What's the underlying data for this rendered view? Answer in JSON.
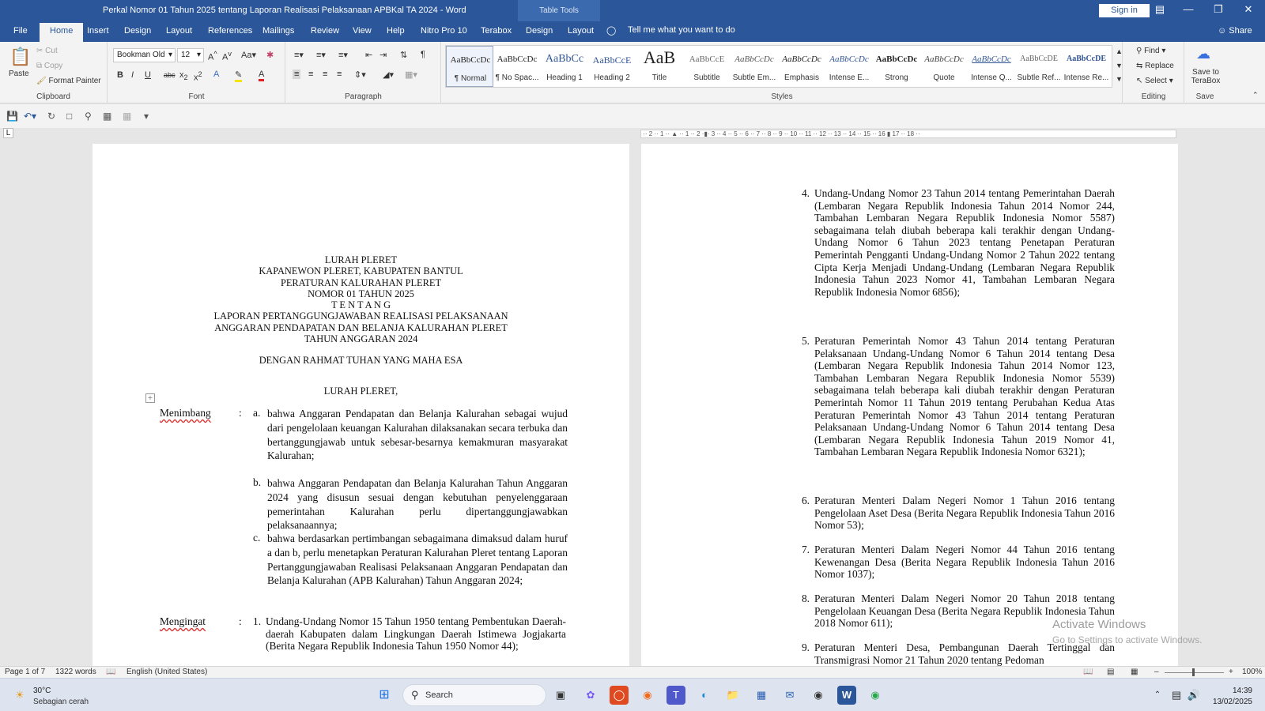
{
  "window": {
    "title": "Perkal Nomor 01 Tahun 2025 tentang Laporan Realisasi Pelaksanaan APBKal TA 2024  -  Word",
    "context_tab": "Table Tools",
    "sign_in": "Sign in"
  },
  "tabs": [
    "File",
    "Home",
    "Insert",
    "Design",
    "Layout",
    "References",
    "Mailings",
    "Review",
    "View",
    "Help",
    "Nitro Pro 10",
    "Terabox",
    "Design",
    "Layout"
  ],
  "active_tab": "Home",
  "tell_me": "Tell me what you want to do",
  "share": "Share",
  "ribbon": {
    "clipboard": {
      "label": "Clipboard",
      "paste": "Paste",
      "cut": "Cut",
      "copy": "Copy",
      "format_painter": "Format Painter"
    },
    "font": {
      "label": "Font",
      "name": "Bookman Old",
      "size": "12"
    },
    "paragraph": {
      "label": "Paragraph"
    },
    "styles": {
      "label": "Styles",
      "items": [
        {
          "preview": "AaBbCcDc",
          "name": "¶ Normal"
        },
        {
          "preview": "AaBbCcDc",
          "name": "¶ No Spac..."
        },
        {
          "preview": "AaBbCc",
          "name": "Heading 1"
        },
        {
          "preview": "AaBbCcE",
          "name": "Heading 2"
        },
        {
          "preview": "AaB",
          "name": "Title"
        },
        {
          "preview": "AaBbCcE",
          "name": "Subtitle"
        },
        {
          "preview": "AaBbCcDc",
          "name": "Subtle Em..."
        },
        {
          "preview": "AaBbCcDc",
          "name": "Emphasis"
        },
        {
          "preview": "AaBbCcDc",
          "name": "Intense E..."
        },
        {
          "preview": "AaBbCcDc",
          "name": "Strong"
        },
        {
          "preview": "AaBbCcDc",
          "name": "Quote"
        },
        {
          "preview": "AaBbCcDc",
          "name": "Intense Q..."
        },
        {
          "preview": "AaBbCcDE",
          "name": "Subtle Ref..."
        },
        {
          "preview": "AaBbCcDE",
          "name": "Intense Re..."
        }
      ]
    },
    "editing": {
      "label": "Editing",
      "find": "Find",
      "replace": "Replace",
      "select": "Select"
    },
    "save": {
      "label": "Save",
      "button": "Save to TeraBox"
    }
  },
  "page1": {
    "heading_lines": [
      "LURAH PLERET",
      "KAPANEWON PLERET, KABUPATEN BANTUL",
      "PERATURAN KALURAHAN PLERET",
      "NOMOR 01 TAHUN 2025",
      "T E N T A N G",
      "LAPORAN PERTANGGUNGJAWABAN REALISASI PELAKSANAAN",
      "ANGGARAN PENDAPATAN DAN BELANJA KALURAHAN PLERET",
      "TAHUN ANGGARAN 2024"
    ],
    "rahmat": "DENGAN RAHMAT TUHAN YANG MAHA ESA",
    "lurah": "LURAH PLERET,",
    "menimbang_label": "Menimbang",
    "menimbang": [
      {
        "mark": "a.",
        "text": "bahwa Anggaran Pendapatan dan Belanja Kalurahan sebagai wujud dari pengelolaan keuangan Kalurahan dilaksanakan secara terbuka dan bertanggungjawab untuk sebesar-besarnya kemakmuran masyarakat Kalurahan;"
      },
      {
        "mark": "b.",
        "text": "bahwa Anggaran Pendapatan dan Belanja Kalurahan Tahun Anggaran 2024 yang disusun sesuai dengan kebutuhan penyelenggaraan pemerintahan Kalurahan perlu dipertanggungjawabkan pelaksanaannya;"
      },
      {
        "mark": "c.",
        "text": "bahwa berdasarkan pertimbangan sebagaimana dimaksud dalam huruf a dan b, perlu menetapkan Peraturan Kalurahan Pleret tentang Laporan Pertanggungjawaban Realisasi Pelaksanaan Anggaran Pendapatan dan Belanja Kalurahan (APB Kalurahan) Tahun Anggaran 2024;"
      }
    ],
    "mengingat_label": "Mengingat",
    "mengingat_first": {
      "mark": "1.",
      "text": "Undang-Undang Nomor 15 Tahun 1950 tentang Pembentukan Daerah-daerah Kabupaten dalam Lingkungan Daerah Istimewa Jogjakarta (Berita Negara Republik Indonesia Tahun 1950 Nomor 44);"
    }
  },
  "page2": {
    "items": [
      {
        "mark": "4.",
        "text": "Undang-Undang Nomor 23 Tahun 2014 tentang Pemerintahan Daerah (Lembaran Negara Republik Indonesia Tahun 2014 Nomor 244, Tambahan Lembaran Negara Republik Indonesia Nomor 5587) sebagaimana telah diubah beberapa kali terakhir dengan Undang-Undang Nomor 6 Tahun 2023 tentang Penetapan Peraturan Pemerintah Pengganti Undang-Undang Nomor 2 Tahun 2022 tentang Cipta Kerja Menjadi Undang-Undang (Lembaran Negara Republik Indonesia Tahun 2023 Nomor 41, Tambahan Lembaran Negara Republik Indonesia Nomor 6856);"
      },
      {
        "mark": "5.",
        "text": "Peraturan Pemerintah Nomor 43 Tahun 2014 tentang Peraturan Pelaksanaan Undang-Undang Nomor 6 Tahun 2014 tentang Desa (Lembaran Negara Republik Indonesia Tahun 2014 Nomor 123, Tambahan Lembaran Negara Republik Indonesia Nomor 5539) sebagaimana telah beberapa kali diubah terakhir dengan Peraturan Pemerintah Nomor 11 Tahun 2019 tentang Perubahan Kedua Atas Peraturan Pemerintah Nomor 43 Tahun 2014 tentang Peraturan Pelaksanaan Undang-Undang Nomor 6 Tahun 2014 tentang Desa (Lembaran Negara Republik Indonesia Tahun 2019 Nomor 41, Tambahan Lembaran Negara Republik Indonesia Nomor 6321);"
      },
      {
        "mark": "6.",
        "text": "Peraturan Menteri Dalam Negeri Nomor 1 Tahun 2016 tentang Pengelolaan Aset Desa (Berita Negara Republik Indonesia Tahun 2016 Nomor 53);"
      },
      {
        "mark": "7.",
        "text": "Peraturan Menteri Dalam Negeri Nomor 44 Tahun 2016 tentang Kewenangan Desa (Berita Negara Republik Indonesia Tahun 2016 Nomor 1037);"
      },
      {
        "mark": "8.",
        "text": "Peraturan Menteri Dalam Negeri Nomor 20 Tahun 2018 tentang Pengelolaan Keuangan Desa (Berita Negara Republik Indonesia Tahun 2018 Nomor 611);"
      },
      {
        "mark": "9.",
        "text": "Peraturan Menteri Desa, Pembangunan Daerah Tertinggal dan Transmigrasi Nomor 21 Tahun 2020 tentang Pedoman"
      }
    ]
  },
  "activate": {
    "title": "Activate Windows",
    "sub": "Go to Settings to activate Windows."
  },
  "status": {
    "page": "Page 1 of 7",
    "words": "1322 words",
    "language": "English (United States)",
    "zoom": "100%"
  },
  "taskbar": {
    "temp": "30°C",
    "weather": "Sebagian cerah",
    "search": "Search",
    "time": "14:39",
    "date": "13/02/2025"
  }
}
